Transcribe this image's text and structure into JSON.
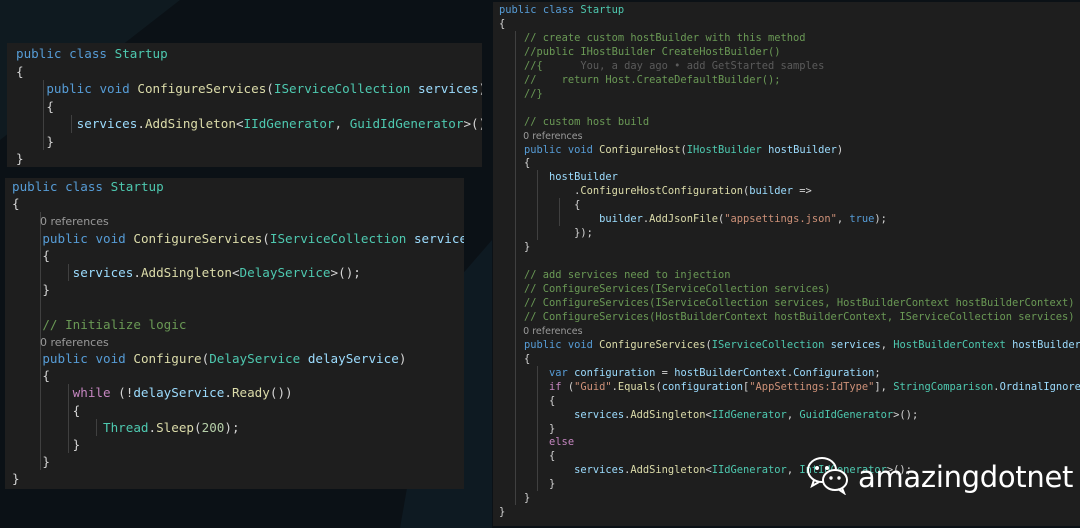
{
  "watermark": {
    "text": "amazingdotnet",
    "icon": "wechat-icon"
  },
  "colors": {
    "background": "#0b1116",
    "panel": "#1e1e1e",
    "keyword": "#569cd6",
    "type": "#4ec9b0",
    "function": "#dcdcaa",
    "variable": "#9cdcfe",
    "comment": "#6a9955",
    "string": "#ce9178",
    "number": "#b5cea8",
    "control": "#c586c0"
  },
  "panels": [
    {
      "lines": [
        [
          [
            "kw",
            "public"
          ],
          [
            "pl",
            " "
          ],
          [
            "kw",
            "class"
          ],
          [
            "pl",
            " "
          ],
          [
            "ty",
            "Startup"
          ]
        ],
        [
          [
            "pl",
            "{"
          ]
        ],
        [
          [
            "pl",
            "    "
          ],
          [
            "kw",
            "public"
          ],
          [
            "pl",
            " "
          ],
          [
            "kw",
            "void"
          ],
          [
            "pl",
            " "
          ],
          [
            "fn",
            "ConfigureServices"
          ],
          [
            "pl",
            "("
          ],
          [
            "ty",
            "IServiceCollection"
          ],
          [
            "pl",
            " "
          ],
          [
            "var",
            "services"
          ],
          [
            "pl",
            ")"
          ]
        ],
        [
          [
            "pl",
            "    {"
          ]
        ],
        [
          [
            "pl",
            "        "
          ],
          [
            "var",
            "services"
          ],
          [
            "pl",
            "."
          ],
          [
            "fn",
            "AddSingleton"
          ],
          [
            "pl",
            "<"
          ],
          [
            "ty",
            "IIdGenerator"
          ],
          [
            "pl",
            ", "
          ],
          [
            "ty",
            "GuidIdGenerator"
          ],
          [
            "pl",
            ">();"
          ]
        ],
        [
          [
            "pl",
            "    }"
          ]
        ],
        [
          [
            "pl",
            "}"
          ]
        ]
      ]
    },
    {
      "lines": [
        [
          [
            "kw",
            "public"
          ],
          [
            "pl",
            " "
          ],
          [
            "kw",
            "class"
          ],
          [
            "pl",
            " "
          ],
          [
            "ty",
            "Startup"
          ]
        ],
        [
          [
            "pl",
            "{"
          ]
        ],
        [
          [
            "ref",
            "        0 references"
          ]
        ],
        [
          [
            "pl",
            "    "
          ],
          [
            "kw",
            "public"
          ],
          [
            "pl",
            " "
          ],
          [
            "kw",
            "void"
          ],
          [
            "pl",
            " "
          ],
          [
            "fn",
            "ConfigureServices"
          ],
          [
            "pl",
            "("
          ],
          [
            "ty",
            "IServiceCollection"
          ],
          [
            "pl",
            " "
          ],
          [
            "var",
            "services"
          ],
          [
            "pl",
            ")"
          ]
        ],
        [
          [
            "pl",
            "    {"
          ]
        ],
        [
          [
            "pl",
            "        "
          ],
          [
            "var",
            "services"
          ],
          [
            "pl",
            "."
          ],
          [
            "fn",
            "AddSingleton"
          ],
          [
            "pl",
            "<"
          ],
          [
            "ty",
            "DelayService"
          ],
          [
            "pl",
            ">();"
          ]
        ],
        [
          [
            "pl",
            "    }"
          ]
        ],
        [
          [
            "pl",
            ""
          ]
        ],
        [
          [
            "pl",
            "    "
          ],
          [
            "cm",
            "// Initialize logic"
          ]
        ],
        [
          [
            "ref",
            "        0 references"
          ]
        ],
        [
          [
            "pl",
            "    "
          ],
          [
            "kw",
            "public"
          ],
          [
            "pl",
            " "
          ],
          [
            "kw",
            "void"
          ],
          [
            "pl",
            " "
          ],
          [
            "fn",
            "Configure"
          ],
          [
            "pl",
            "("
          ],
          [
            "ty",
            "DelayService"
          ],
          [
            "pl",
            " "
          ],
          [
            "var",
            "delayService"
          ],
          [
            "pl",
            ")"
          ]
        ],
        [
          [
            "pl",
            "    {"
          ]
        ],
        [
          [
            "pl",
            "        "
          ],
          [
            "ctl",
            "while"
          ],
          [
            "pl",
            " (!"
          ],
          [
            "var",
            "delayService"
          ],
          [
            "pl",
            "."
          ],
          [
            "fn",
            "Ready"
          ],
          [
            "pl",
            "())"
          ]
        ],
        [
          [
            "pl",
            "        {"
          ]
        ],
        [
          [
            "pl",
            "            "
          ],
          [
            "ty",
            "Thread"
          ],
          [
            "pl",
            "."
          ],
          [
            "fn",
            "Sleep"
          ],
          [
            "pl",
            "("
          ],
          [
            "num",
            "200"
          ],
          [
            "pl",
            ");"
          ]
        ],
        [
          [
            "pl",
            "        }"
          ]
        ],
        [
          [
            "pl",
            "    }"
          ]
        ],
        [
          [
            "pl",
            "}"
          ]
        ]
      ]
    },
    {
      "lines": [
        [
          [
            "kw",
            "public"
          ],
          [
            "pl",
            " "
          ],
          [
            "kw",
            "class"
          ],
          [
            "pl",
            " "
          ],
          [
            "ty",
            "Startup"
          ]
        ],
        [
          [
            "pl",
            "{"
          ]
        ],
        [
          [
            "pl",
            "    "
          ],
          [
            "cm",
            "// create custom hostBuilder with this method"
          ]
        ],
        [
          [
            "pl",
            "    "
          ],
          [
            "cm",
            "//public IHostBuilder CreateHostBuilder()"
          ]
        ],
        [
          [
            "pl",
            "    "
          ],
          [
            "cm",
            "//{"
          ],
          [
            "hint",
            "      You, a day ago • add GetStarted samples"
          ]
        ],
        [
          [
            "pl",
            "    "
          ],
          [
            "cm",
            "//    return Host.CreateDefaultBuilder();"
          ]
        ],
        [
          [
            "pl",
            "    "
          ],
          [
            "cm",
            "//}"
          ]
        ],
        [
          [
            "pl",
            ""
          ]
        ],
        [
          [
            "pl",
            "    "
          ],
          [
            "cm",
            "// custom host build"
          ]
        ],
        [
          [
            "ref",
            "        0 references"
          ]
        ],
        [
          [
            "pl",
            "    "
          ],
          [
            "kw",
            "public"
          ],
          [
            "pl",
            " "
          ],
          [
            "kw",
            "void"
          ],
          [
            "pl",
            " "
          ],
          [
            "fn",
            "ConfigureHost"
          ],
          [
            "pl",
            "("
          ],
          [
            "ty",
            "IHostBuilder"
          ],
          [
            "pl",
            " "
          ],
          [
            "var",
            "hostBuilder"
          ],
          [
            "pl",
            ")"
          ]
        ],
        [
          [
            "pl",
            "    {"
          ]
        ],
        [
          [
            "pl",
            "        "
          ],
          [
            "var",
            "hostBuilder"
          ]
        ],
        [
          [
            "pl",
            "            ."
          ],
          [
            "fn",
            "ConfigureHostConfiguration"
          ],
          [
            "pl",
            "("
          ],
          [
            "var",
            "builder"
          ],
          [
            "pl",
            " =>"
          ]
        ],
        [
          [
            "pl",
            "            {"
          ]
        ],
        [
          [
            "pl",
            "                "
          ],
          [
            "var",
            "builder"
          ],
          [
            "pl",
            "."
          ],
          [
            "fn",
            "AddJsonFile"
          ],
          [
            "pl",
            "("
          ],
          [
            "str",
            "\"appsettings.json\""
          ],
          [
            "pl",
            ", "
          ],
          [
            "kw",
            "true"
          ],
          [
            "pl",
            ");"
          ]
        ],
        [
          [
            "pl",
            "            });"
          ]
        ],
        [
          [
            "pl",
            "    }"
          ]
        ],
        [
          [
            "pl",
            ""
          ]
        ],
        [
          [
            "pl",
            "    "
          ],
          [
            "cm",
            "// add services need to injection"
          ]
        ],
        [
          [
            "pl",
            "    "
          ],
          [
            "cm",
            "// ConfigureServices(IServiceCollection services)"
          ]
        ],
        [
          [
            "pl",
            "    "
          ],
          [
            "cm",
            "// ConfigureServices(IServiceCollection services, HostBuilderContext hostBuilderContext)"
          ]
        ],
        [
          [
            "pl",
            "    "
          ],
          [
            "cm",
            "// ConfigureServices(HostBuilderContext hostBuilderContext, IServiceCollection services)"
          ]
        ],
        [
          [
            "ref",
            "        0 references"
          ]
        ],
        [
          [
            "pl",
            "    "
          ],
          [
            "kw",
            "public"
          ],
          [
            "pl",
            " "
          ],
          [
            "kw",
            "void"
          ],
          [
            "pl",
            " "
          ],
          [
            "fn",
            "ConfigureServices"
          ],
          [
            "pl",
            "("
          ],
          [
            "ty",
            "IServiceCollection"
          ],
          [
            "pl",
            " "
          ],
          [
            "var",
            "services"
          ],
          [
            "pl",
            ", "
          ],
          [
            "ty",
            "HostBuilderContext"
          ],
          [
            "pl",
            " "
          ],
          [
            "var",
            "hostBuilderContext"
          ],
          [
            "pl",
            ")"
          ]
        ],
        [
          [
            "pl",
            "    {"
          ]
        ],
        [
          [
            "pl",
            "        "
          ],
          [
            "kw",
            "var"
          ],
          [
            "pl",
            " "
          ],
          [
            "var",
            "configuration"
          ],
          [
            "pl",
            " = "
          ],
          [
            "var",
            "hostBuilderContext"
          ],
          [
            "pl",
            "."
          ],
          [
            "var",
            "Configuration"
          ],
          [
            "pl",
            ";"
          ]
        ],
        [
          [
            "pl",
            "        "
          ],
          [
            "ctl",
            "if"
          ],
          [
            "pl",
            " ("
          ],
          [
            "str",
            "\"Guid\""
          ],
          [
            "pl",
            "."
          ],
          [
            "fn",
            "Equals"
          ],
          [
            "pl",
            "("
          ],
          [
            "var",
            "configuration"
          ],
          [
            "pl",
            "["
          ],
          [
            "str",
            "\"AppSettings:IdType\""
          ],
          [
            "pl",
            "], "
          ],
          [
            "ty",
            "StringComparison"
          ],
          [
            "pl",
            "."
          ],
          [
            "var",
            "OrdinalIgnoreCase"
          ],
          [
            "pl",
            "))"
          ]
        ],
        [
          [
            "pl",
            "        {"
          ]
        ],
        [
          [
            "pl",
            "            "
          ],
          [
            "var",
            "services"
          ],
          [
            "pl",
            "."
          ],
          [
            "fn",
            "AddSingleton"
          ],
          [
            "pl",
            "<"
          ],
          [
            "ty",
            "IIdGenerator"
          ],
          [
            "pl",
            ", "
          ],
          [
            "ty",
            "GuidIdGenerator"
          ],
          [
            "pl",
            ">();"
          ]
        ],
        [
          [
            "pl",
            "        }"
          ]
        ],
        [
          [
            "pl",
            "        "
          ],
          [
            "ctl",
            "else"
          ]
        ],
        [
          [
            "pl",
            "        {"
          ]
        ],
        [
          [
            "pl",
            "            "
          ],
          [
            "var",
            "services"
          ],
          [
            "pl",
            "."
          ],
          [
            "fn",
            "AddSingleton"
          ],
          [
            "pl",
            "<"
          ],
          [
            "ty",
            "IIdGenerator"
          ],
          [
            "pl",
            ", "
          ],
          [
            "ty",
            "IntIdGenerator"
          ],
          [
            "pl",
            ">();"
          ]
        ],
        [
          [
            "pl",
            "        }"
          ]
        ],
        [
          [
            "pl",
            "    }"
          ]
        ],
        [
          [
            "pl",
            "}"
          ]
        ]
      ]
    }
  ]
}
